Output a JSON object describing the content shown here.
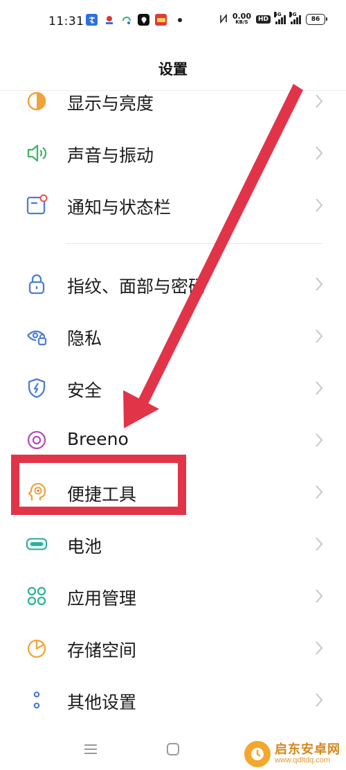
{
  "status_bar": {
    "time": "11:31",
    "net_speed_value": "0.00",
    "net_speed_unit": "KB/S",
    "hd_label": "HD",
    "sim1_tag": "5G",
    "sim2_tag": "4G",
    "battery_level": "86",
    "left_icons": [
      "notification-app-icon",
      "notification-app-icon",
      "notification-app-icon",
      "notification-app-icon",
      "notification-app-icon"
    ]
  },
  "header": {
    "title": "设置"
  },
  "settings": {
    "items": [
      {
        "label": "显示与亮度",
        "icon": "display-brightness-icon",
        "color": "#f0a33a"
      },
      {
        "label": "声音与振动",
        "icon": "sound-vibration-icon",
        "color": "#3fb36b"
      },
      {
        "label": "通知与状态栏",
        "icon": "notification-statusbar-icon",
        "color": "#4a7dd8"
      },
      {
        "label": "指纹、面部与密码",
        "icon": "lock-icon",
        "color": "#4a7dd8"
      },
      {
        "label": "隐私",
        "icon": "privacy-eye-icon",
        "color": "#4a7dd8"
      },
      {
        "label": "安全",
        "icon": "security-shield-icon",
        "color": "#4a7dd8"
      },
      {
        "label": "Breeno",
        "icon": "breeno-icon",
        "color": "#b04fbc"
      },
      {
        "label": "便捷工具",
        "icon": "convenience-tools-icon",
        "color": "#f0a33a"
      },
      {
        "label": "电池",
        "icon": "battery-icon",
        "color": "#2bb39a"
      },
      {
        "label": "应用管理",
        "icon": "app-management-icon",
        "color": "#2bb39a"
      },
      {
        "label": "存储空间",
        "icon": "storage-icon",
        "color": "#f0a33a"
      },
      {
        "label": "其他设置",
        "icon": "other-settings-icon",
        "color": "#4a7dd8"
      }
    ]
  },
  "annotation": {
    "highlight_color": "#e23449",
    "highlighted_item": "便捷工具"
  },
  "watermark": {
    "name": "启东安卓网",
    "url": "www.qdltdq.com"
  }
}
